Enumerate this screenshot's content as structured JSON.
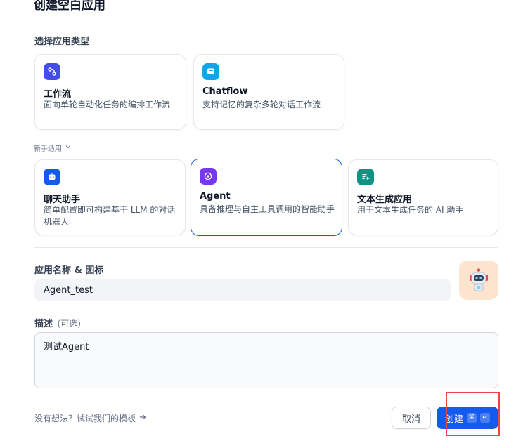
{
  "header": {
    "title": "创建空白应用"
  },
  "app_type_section": {
    "label": "选择应用类型"
  },
  "primary_types": [
    {
      "title": "工作流",
      "desc": "面向单轮自动化任务的编排工作流",
      "icon": "workflow-icon",
      "color": "#444ce7"
    },
    {
      "title": "Chatflow",
      "desc": "支持记忆的复杂多轮对话工作流",
      "icon": "chatflow-icon",
      "color": "#0ba5ec"
    }
  ],
  "beginner": {
    "label": "新手适用"
  },
  "beginner_types": [
    {
      "title": "聊天助手",
      "desc": "简单配置即可构建基于 LLM 的对话机器人",
      "icon": "chatbot-icon",
      "color": "#155aef"
    },
    {
      "title": "Agent",
      "desc": "具备推理与自主工具调用的智能助手",
      "icon": "agent-icon",
      "color": "#7839ee",
      "selected": true
    },
    {
      "title": "文本生成应用",
      "desc": "用于文本生成任务的 AI 助手",
      "icon": "text-generation-icon",
      "color": "#0e9384"
    }
  ],
  "name_section": {
    "label": "应用名称 & 图标",
    "value": "Agent_test"
  },
  "desc_section": {
    "label": "描述",
    "optional": "(可选)",
    "value": "测试Agent"
  },
  "footer": {
    "template_link": "没有想法？试试我们的模板",
    "cancel": "取消",
    "create": "创建",
    "shortcut_cmd": "⌘",
    "shortcut_enter": "↵"
  },
  "colors": {
    "primary": "#155aef",
    "highlight": "#ef4444",
    "avatar_bg": "#fde4cf"
  }
}
